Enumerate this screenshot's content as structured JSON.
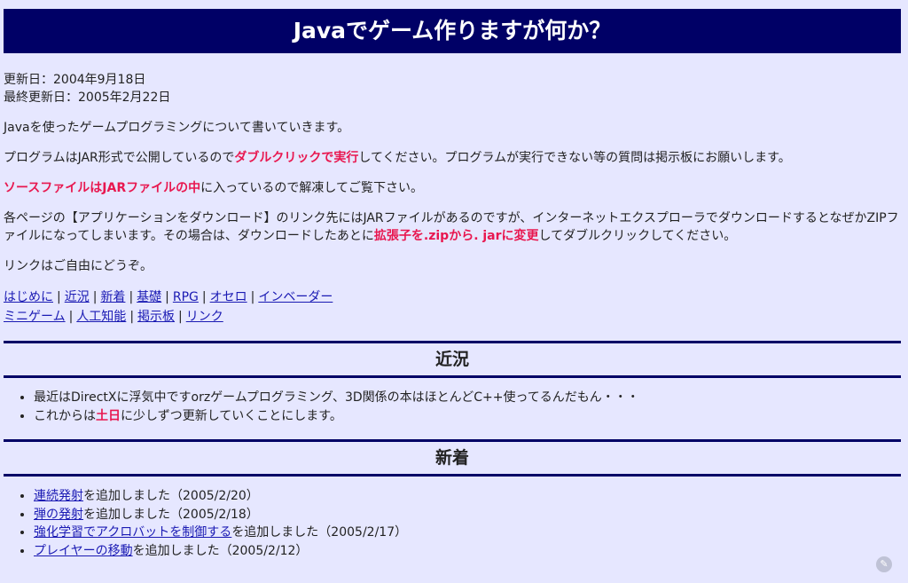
{
  "header": {
    "title": "Javaでゲーム作りますが何か？"
  },
  "dates": {
    "updated": "更新日：2004年9月18日",
    "last_updated": "最終更新日：2005年2月22日"
  },
  "intro": {
    "p1": "Javaを使ったゲームプログラミングについて書いていきます。",
    "p2_a": "プログラムはJAR形式で公開しているので",
    "p2_em": "ダブルクリックで実行",
    "p2_b": "してください。プログラムが実行できない等の質問は掲示板にお願いします。",
    "p3_em": "ソースファイルはJARファイルの中",
    "p3_b": "に入っているので解凍してご覧下さい。",
    "p4_a": "各ページの【アプリケーションをダウンロード】のリンク先にはJARファイルがあるのですが、インターネットエクスプローラでダウンロードするとなぜかZIPファイルになってしまいます。その場合は、ダウンロードしたあとに",
    "p4_em": "拡張子を.zipから. jarに変更",
    "p4_b": "してダブルクリックしてください。",
    "p5": "リンクはご自由にどうぞ。"
  },
  "nav": {
    "sep": "|",
    "row1": [
      "はじめに",
      "近況",
      "新着",
      "基礎",
      "RPG",
      "オセロ",
      "インベーダー"
    ],
    "row2": [
      "ミニゲーム",
      "人工知能",
      "掲示板",
      "リンク"
    ]
  },
  "news": {
    "heading": "近況",
    "item1": "最近はDirectXに浮気中ですorzゲームプログラミング、3D関係の本はほとんどC++使ってるんだもん・・・",
    "item2_a": "これからは",
    "item2_em": "土日",
    "item2_b": "に少しずつ更新していくことにします。"
  },
  "updates": {
    "heading": "新着",
    "items": [
      {
        "link": "連続発射",
        "text": "を追加しました（2005/2/20）"
      },
      {
        "link": "弾の発射",
        "text": "を追加しました（2005/2/18）"
      },
      {
        "link": "強化学習でアクロバットを制御する",
        "text": "を追加しました（2005/2/17）"
      },
      {
        "link": "プレイヤーの移動",
        "text": "を追加しました（2005/2/12）"
      }
    ]
  },
  "colors": {
    "banner": "#000066",
    "background": "#e6e7ff",
    "emphasis": "#e8174f",
    "link": "#1a1ab3"
  },
  "icons": {
    "corner": "pencil-icon"
  }
}
